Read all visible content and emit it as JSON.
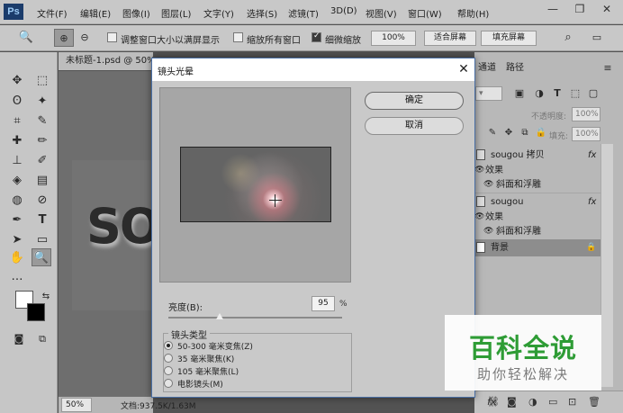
{
  "app": {
    "logo": "Ps"
  },
  "menu": {
    "items": [
      "文件(F)",
      "编辑(E)",
      "图像(I)",
      "图层(L)",
      "文字(Y)",
      "选择(S)",
      "滤镜(T)",
      "3D(D)",
      "视图(V)",
      "窗口(W)",
      "帮助(H)"
    ]
  },
  "window_controls": {
    "minimize": "—",
    "restore": "❐",
    "close": "✕"
  },
  "options_bar": {
    "resize_windows_label": "调整窗口大小以满屏显示",
    "zoom_all_windows_label": "缩放所有窗口",
    "scrubby_zoom_label": "细微缩放",
    "zoom_percent": "100%",
    "fit_screen_button": "适合屏幕",
    "fill_screen_button": "填充屏幕"
  },
  "document": {
    "tab_title": "未标题-1.psd @ 50% (背景",
    "canvas_text": "SO",
    "zoom": "50%",
    "doc_info": "文档:937.5K/1.63M"
  },
  "panels": {
    "tabs": [
      "通道",
      "路径"
    ],
    "opacity_label": "不透明度:",
    "opacity_value": "100%",
    "fill_label": "填充:",
    "fill_value": "100%",
    "layers": [
      {
        "name": "sougou 拷贝",
        "fx": "fx"
      },
      {
        "name": "效果"
      },
      {
        "name": "斜面和浮雕"
      },
      {
        "name": "sougou",
        "fx": "fx"
      },
      {
        "name": "效果"
      },
      {
        "name": "斜面和浮雕"
      },
      {
        "name": "背景"
      }
    ]
  },
  "dialog": {
    "title": "镜头光晕",
    "close": "✕",
    "ok_button": "确定",
    "cancel_button": "取消",
    "brightness_label": "亮度(B):",
    "brightness_value": "95",
    "brightness_unit": "%",
    "brightness_level_percent": 95,
    "lens_type_title": "镜头类型",
    "lens_options": [
      "50-300 毫米变焦(Z)",
      "35 毫米聚焦(K)",
      "105 毫米聚焦(L)",
      "电影镜头(M)"
    ],
    "selected_lens_index": 0
  },
  "watermark": {
    "title": "百科全说",
    "subtitle": "助你轻松解决"
  },
  "colors": {
    "watermark_green": "#2e9c35",
    "dialog_border": "#4a6fa5"
  }
}
